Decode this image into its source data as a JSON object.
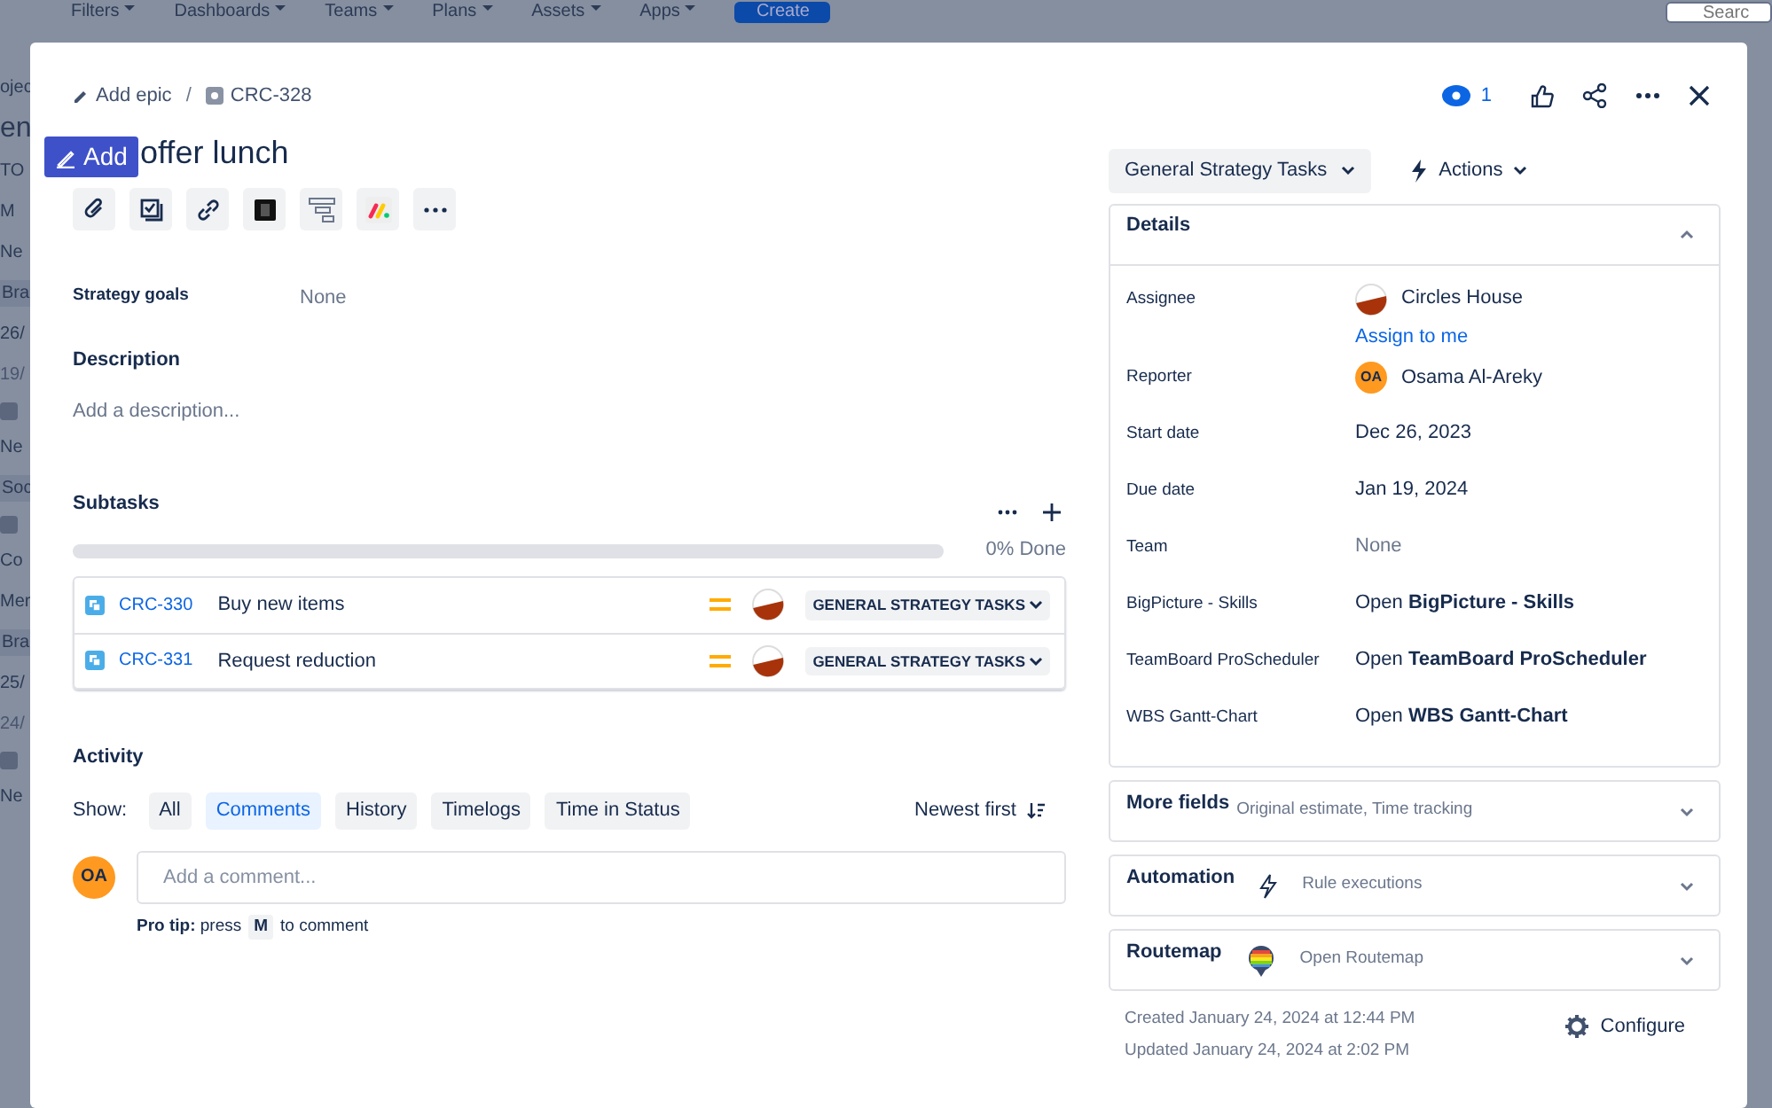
{
  "background": {
    "nav_items": [
      "Filters",
      "Dashboards",
      "Teams",
      "Plans",
      "Assets",
      "Apps"
    ],
    "create_button": "Create",
    "search_placeholder": "Searc",
    "side_fragments": [
      {
        "text": "ojec",
        "kind": "small"
      },
      {
        "text": "en",
        "kind": "large"
      },
      {
        "text": "TO",
        "kind": "small"
      },
      {
        "text": "M",
        "kind": "normal"
      },
      {
        "text": "Ne",
        "kind": "normal"
      },
      {
        "text": "Bra",
        "kind": "chip"
      },
      {
        "text": "26/",
        "kind": "normal"
      },
      {
        "text": "19/",
        "kind": "muted"
      },
      {
        "kind": "icon"
      },
      {
        "text": "Ne",
        "kind": "normal"
      },
      {
        "text": "Soc",
        "kind": "chip"
      },
      {
        "kind": "icon"
      },
      {
        "text": "Co",
        "kind": "normal"
      },
      {
        "text": "Mer",
        "kind": "normal"
      },
      {
        "text": "Bra",
        "kind": "chip"
      },
      {
        "text": "25/",
        "kind": "normal"
      },
      {
        "text": "24/",
        "kind": "muted"
      },
      {
        "kind": "icon"
      },
      {
        "text": "Ne",
        "kind": "normal"
      }
    ]
  },
  "floating_button": {
    "label": "Add"
  },
  "issue": {
    "breadcrumb": {
      "epic_link": "Add epic",
      "separator": "/",
      "key": "CRC-328"
    },
    "header_actions": {
      "watchers": "1"
    },
    "title": "offer lunch",
    "toolbar": [
      {
        "kind": "attach"
      },
      {
        "kind": "checklist"
      },
      {
        "kind": "link"
      },
      {
        "kind": "app-dark"
      },
      {
        "kind": "hierarchy"
      },
      {
        "kind": "monday"
      },
      {
        "kind": "more"
      }
    ],
    "strategy_goals": {
      "label": "Strategy goals",
      "value": "None"
    },
    "description": {
      "heading": "Description",
      "placeholder": "Add a description..."
    },
    "subtasks": {
      "heading": "Subtasks",
      "level": 0,
      "progress_text": "0% Done",
      "rows": [
        {
          "key": "CRC-330",
          "summary": "Buy new items",
          "status": "GENERAL STRATEGY TASKS"
        },
        {
          "key": "CRC-331",
          "summary": "Request reduction",
          "status": "GENERAL STRATEGY TASKS"
        }
      ]
    },
    "activity": {
      "heading": "Activity",
      "show_label": "Show:",
      "filters": [
        {
          "label": "All",
          "selected": false
        },
        {
          "label": "Comments",
          "selected": true
        },
        {
          "label": "History",
          "selected": false
        },
        {
          "label": "Timelogs",
          "selected": false
        },
        {
          "label": "Time in Status",
          "selected": false
        }
      ],
      "sort": "Newest first",
      "avatar": "OA",
      "comment_placeholder": "Add a comment...",
      "pro_tip": {
        "label": "Pro tip:",
        "before": "press",
        "key": "M",
        "after": "to comment"
      }
    },
    "status_button": "General Strategy Tasks",
    "actions_button": "Actions",
    "details": {
      "heading": "Details",
      "expanded": true,
      "fields": [
        {
          "label": "Assignee",
          "kind": "user",
          "value": "Circles House",
          "link": "Assign to me"
        },
        {
          "label": "Reporter",
          "kind": "user",
          "avatar": "OA",
          "value": "Osama Al-Areky"
        },
        {
          "label": "Start date",
          "kind": "text",
          "value": "Dec 26, 2023"
        },
        {
          "label": "Due date",
          "kind": "text",
          "value": "Jan 19, 2024"
        },
        {
          "label": "Team",
          "kind": "empty",
          "value": "None"
        },
        {
          "label": "BigPicture - Skills",
          "kind": "app",
          "value": "Open **BigPicture - Skills**"
        },
        {
          "label": "TeamBoard ProScheduler",
          "kind": "app",
          "value": "Open **TeamBoard ProScheduler**"
        },
        {
          "label": "WBS Gantt-Chart",
          "kind": "app",
          "value": "Open **WBS Gantt-Chart**"
        }
      ]
    },
    "panels": [
      {
        "heading": "More fields",
        "kind": "plain",
        "hint": "Original estimate, Time tracking",
        "expanded": false
      },
      {
        "heading": "Automation",
        "kind": "bolt",
        "hint": "Rule executions",
        "expanded": false
      },
      {
        "heading": "Routemap",
        "kind": "pin",
        "hint": "Open Routemap",
        "expanded": false
      }
    ],
    "created": "Created January 24, 2024 at 12:44 PM",
    "updated": "Updated January 24, 2024 at 2:02 PM",
    "configure": "Configure"
  }
}
